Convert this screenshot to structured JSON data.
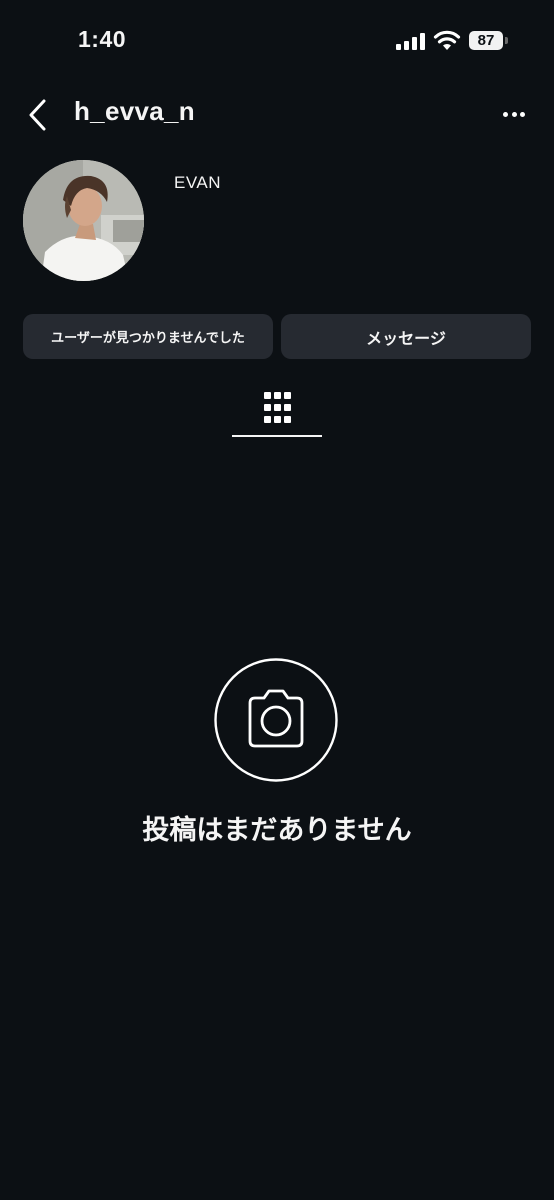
{
  "status_bar": {
    "time": "1:40",
    "battery": "87"
  },
  "header": {
    "username": "h_evva_n",
    "back_icon": "chevron-left-icon",
    "more_icon": "ellipsis-icon"
  },
  "profile": {
    "display_name": "EVAN"
  },
  "actions": {
    "status_label": "ユーザーが見つかりませんでした",
    "message_label": "メッセージ"
  },
  "tabs": {
    "grid_icon": "grid-icon"
  },
  "empty_state": {
    "icon": "camera-icon",
    "text": "投稿はまだありません"
  },
  "colors": {
    "background": "#0c1014",
    "button_bg": "#262a31",
    "text": "#f5f5f5"
  }
}
